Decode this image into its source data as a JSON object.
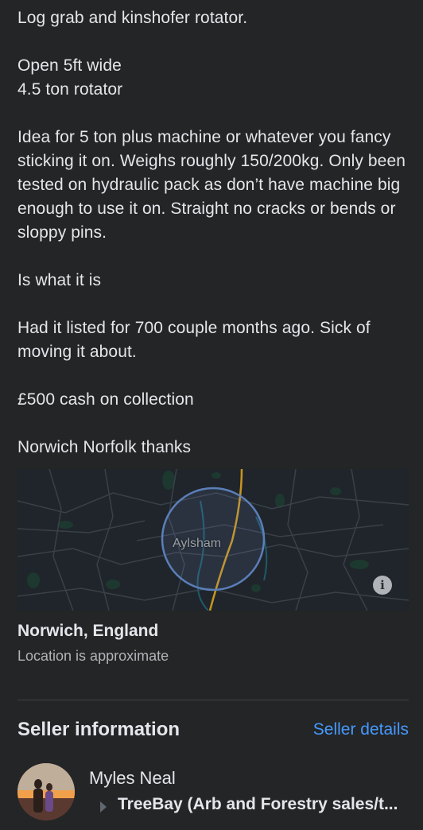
{
  "listing": {
    "description": [
      "Log grab and kinshofer rotator.",
      "Open 5ft wide\n4.5 ton rotator",
      "Idea for  5 ton plus machine or whatever you fancy sticking it on. Weighs roughly 150/200kg. Only been tested on hydraulic pack as don’t have machine big enough to use it on.  Straight no cracks or bends or sloppy pins.",
      "Is what it is",
      "Had it listed for 700 couple months ago. Sick of moving it about.",
      "£500 cash on collection",
      "Norwich Norfolk thanks"
    ]
  },
  "map": {
    "place_label": "Aylsham",
    "info_icon": "info-icon"
  },
  "location": {
    "title": "Norwich, England",
    "subtitle": "Location is approximate"
  },
  "seller": {
    "heading": "Seller information",
    "details_link": "Seller details",
    "name": "Myles Neal",
    "group": "TreeBay (Arb and Forestry sales/t..."
  },
  "colors": {
    "background": "#242526",
    "text_primary": "#e4e6eb",
    "text_secondary": "#b0b3b8",
    "link": "#4599ff",
    "road": "#c8961e"
  }
}
